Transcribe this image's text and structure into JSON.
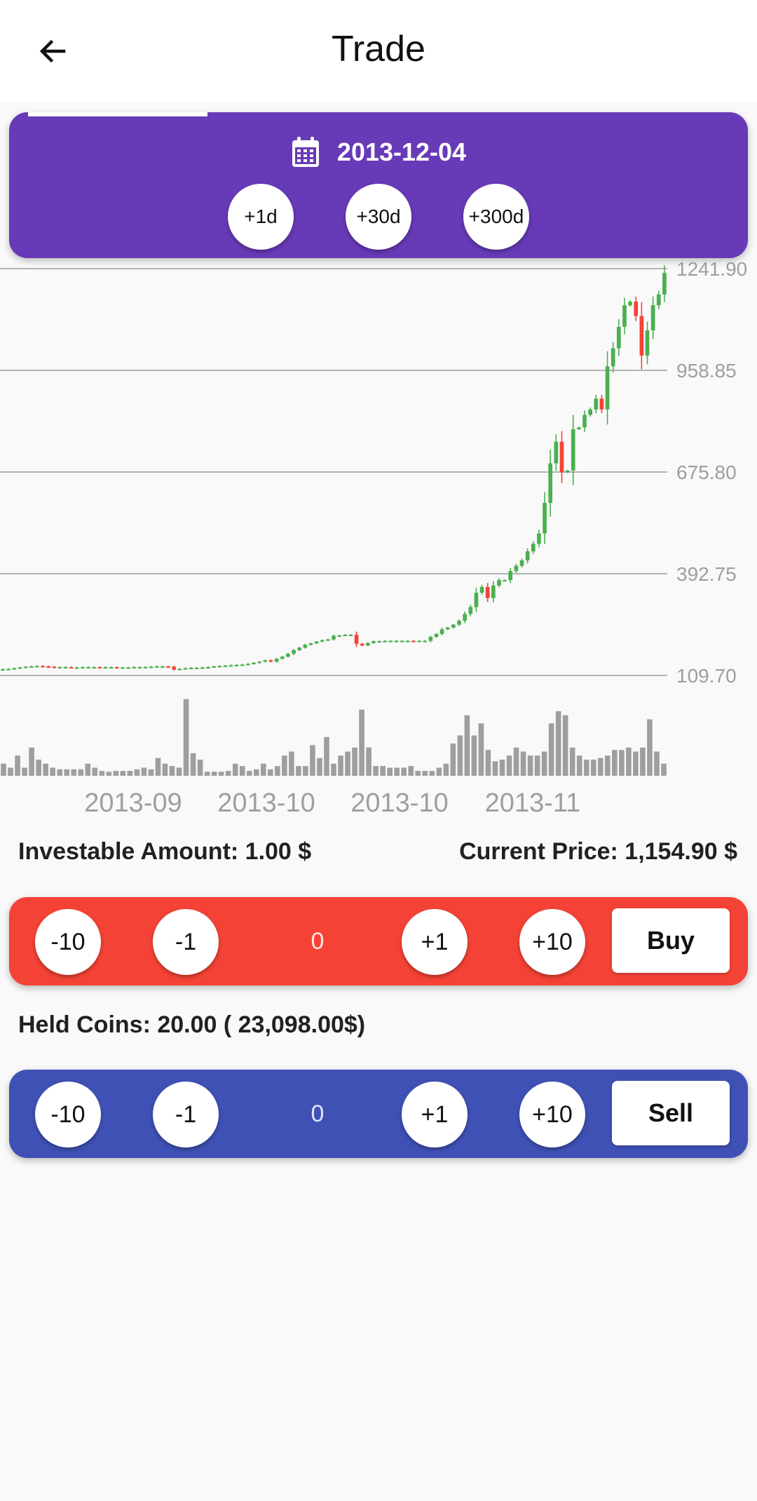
{
  "appbar": {
    "title": "Trade",
    "back_icon": "arrow-left-icon"
  },
  "date_picker": {
    "date": "2013-12-04",
    "icon": "calendar-icon",
    "increments": [
      "+1d",
      "+30d",
      "+300d"
    ]
  },
  "chart_data": {
    "type": "candlestick",
    "y_ticks": [
      "1241.90",
      "958.85",
      "675.80",
      "392.75",
      "109.70"
    ],
    "x_tick_labels": [
      "2013-09",
      "2013-10",
      "2013-10",
      "2013-11"
    ],
    "ylim": [
      109.7,
      1241.9
    ],
    "up_color": "#4caf50",
    "down_color": "#f44336",
    "volume_color": "#9e9e9e",
    "grid": true,
    "candles_close": [
      127,
      128,
      130,
      132,
      134,
      135,
      136,
      135,
      134,
      133,
      133,
      133,
      132,
      132,
      133,
      133,
      133,
      132,
      133,
      133,
      132,
      132,
      132,
      133,
      133,
      133,
      134,
      135,
      135,
      134,
      126,
      128,
      130,
      131,
      131,
      132,
      133,
      135,
      136,
      137,
      138,
      139,
      140,
      142,
      145,
      148,
      152,
      148,
      156,
      162,
      170,
      180,
      187,
      195,
      199,
      204,
      208,
      210,
      220,
      221,
      223,
      223,
      198,
      193,
      200,
      205,
      205,
      206,
      206,
      206,
      206,
      206,
      205,
      206,
      206,
      217,
      225,
      238,
      243,
      251,
      262,
      281,
      300,
      340,
      356,
      325,
      360,
      375,
      375,
      400,
      415,
      430,
      455,
      476,
      505,
      590,
      700,
      760,
      675,
      680,
      795,
      800,
      835,
      850,
      880,
      850,
      970,
      1020,
      1080,
      1140,
      1150,
      1110,
      1000,
      1070,
      1140,
      1170,
      1230
    ],
    "volume_rel": [
      0.15,
      0.1,
      0.25,
      0.1,
      0.35,
      0.2,
      0.15,
      0.1,
      0.08,
      0.08,
      0.08,
      0.08,
      0.15,
      0.1,
      0.06,
      0.05,
      0.06,
      0.06,
      0.06,
      0.08,
      0.1,
      0.08,
      0.22,
      0.15,
      0.12,
      0.1,
      0.95,
      0.28,
      0.2,
      0.05,
      0.05,
      0.05,
      0.06,
      0.15,
      0.12,
      0.06,
      0.08,
      0.15,
      0.08,
      0.12,
      0.25,
      0.3,
      0.12,
      0.12,
      0.38,
      0.22,
      0.48,
      0.15,
      0.25,
      0.3,
      0.35,
      0.82,
      0.35,
      0.12,
      0.12,
      0.1,
      0.1,
      0.1,
      0.12,
      0.06,
      0.06,
      0.06,
      0.1,
      0.15,
      0.4,
      0.5,
      0.75,
      0.5,
      0.65,
      0.32,
      0.18,
      0.2,
      0.25,
      0.35,
      0.3,
      0.25,
      0.25,
      0.3,
      0.65,
      0.8,
      0.75,
      0.35,
      0.25,
      0.2,
      0.2,
      0.22,
      0.25,
      0.32,
      0.32,
      0.35,
      0.3,
      0.35,
      0.7,
      0.3,
      0.15
    ]
  },
  "investable": {
    "label": "Investable Amount: 1.00 $"
  },
  "current_price": {
    "label": "Current Price: 1,154.90 $"
  },
  "buy": {
    "buttons": [
      "-10",
      "-1",
      "+1",
      "+10"
    ],
    "qty": "0",
    "action": "Buy"
  },
  "held": {
    "label": "Held Coins: 20.00 ( 23,098.00$)"
  },
  "sell": {
    "buttons": [
      "-10",
      "-1",
      "+1",
      "+10"
    ],
    "qty": "0",
    "action": "Sell"
  }
}
